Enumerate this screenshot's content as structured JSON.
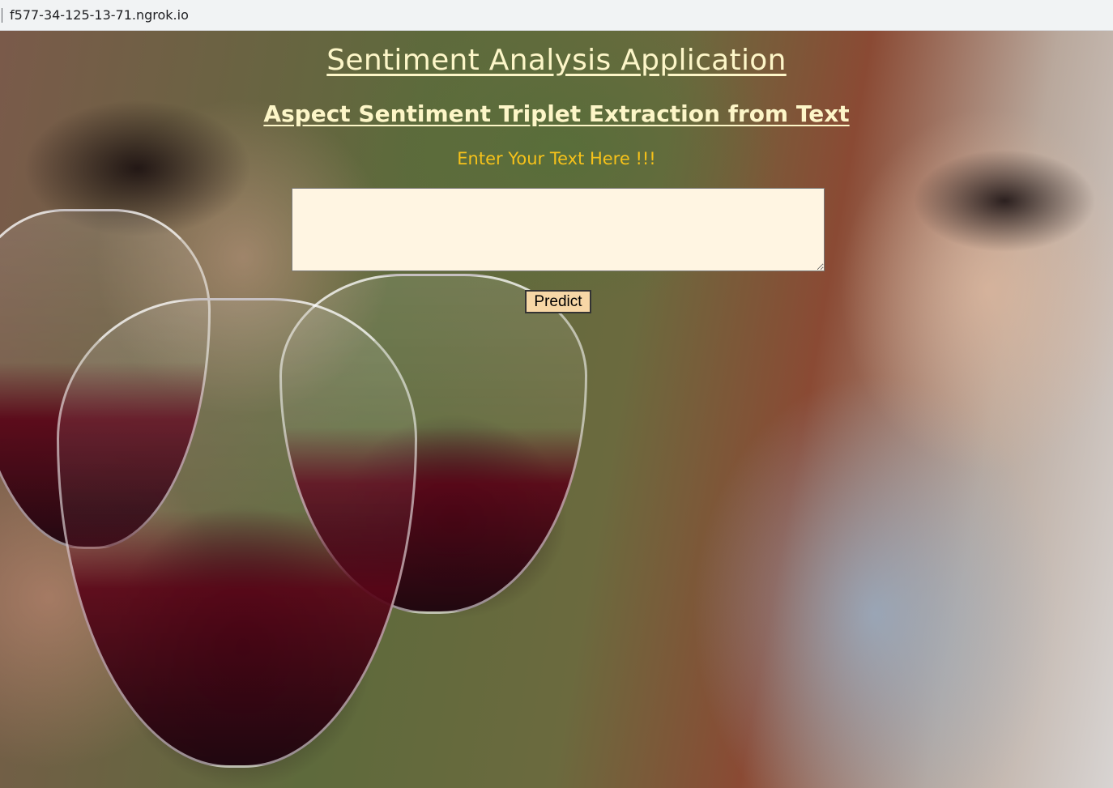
{
  "browser": {
    "url": "f577-34-125-13-71.ngrok.io"
  },
  "page": {
    "title": "Sentiment Analysis Application",
    "subtitle": "Aspect Sentiment Triplet Extraction from Text",
    "prompt": "Enter Your Text Here !!!",
    "text_input": {
      "value": "",
      "placeholder": ""
    },
    "predict_label": "Predict"
  },
  "colors": {
    "heading": "#fdf6c8",
    "prompt": "#f6c21a",
    "textarea_bg": "#fff5e2",
    "button_bg": "#f7d7a6"
  }
}
